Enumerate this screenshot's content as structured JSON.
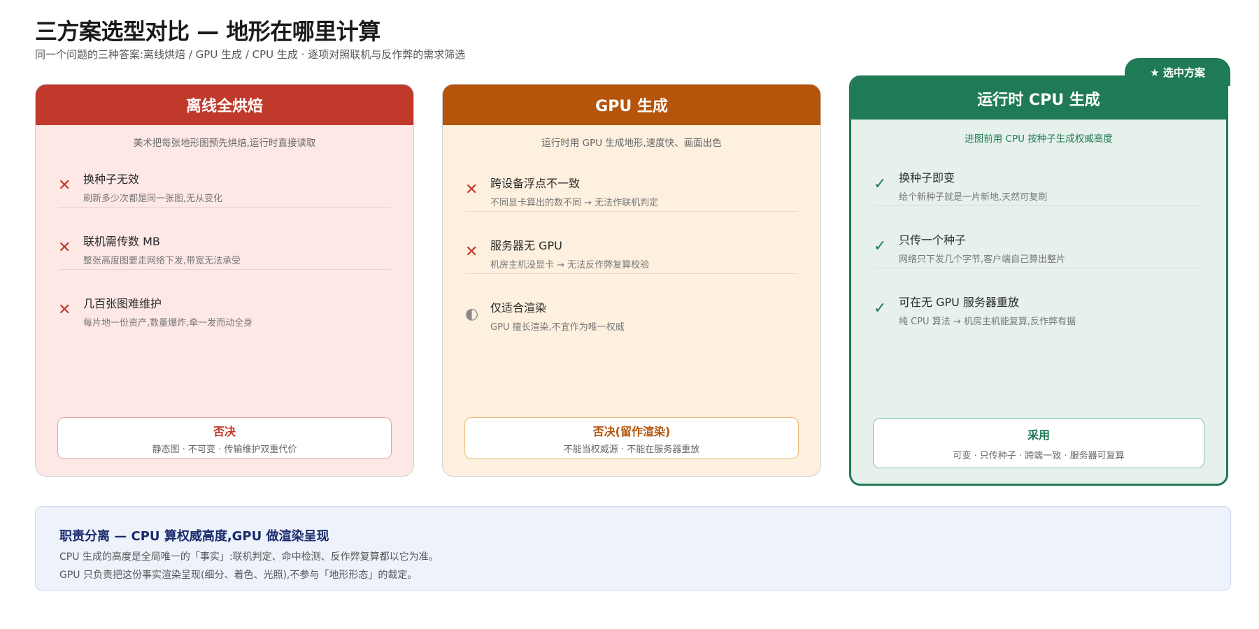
{
  "header": {
    "title": "三方案选型对比 — 地形在哪里计算",
    "subtitle": "同一个问题的三种答案:离线烘焙 / GPU 生成 / CPU 生成 · 逐项对照联机与反作弊的需求筛选"
  },
  "badge": "★ 选中方案",
  "cards": [
    {
      "title": "离线全烘焙",
      "desc": "美术把每张地形图预先烘焙,运行时直接读取",
      "items": [
        {
          "mark": "✕",
          "title": "换种子无效",
          "sub": "刷新多少次都是同一张图,无从变化"
        },
        {
          "mark": "✕",
          "title": "联机需传数 MB",
          "sub": "整张高度图要走网络下发,带宽无法承受"
        },
        {
          "mark": "✕",
          "title": "几百张图难维护",
          "sub": "每片地一份资产,数量爆炸,牵一发而动全身"
        }
      ],
      "verdict": {
        "label": "否决",
        "note": "静态图 · 不可变 · 传输维护双重代价"
      }
    },
    {
      "title": "GPU 生成",
      "desc": "运行时用 GPU 生成地形,速度快、画面出色",
      "items": [
        {
          "mark": "✕",
          "title": "跨设备浮点不一致",
          "sub": "不同显卡算出的数不同 → 无法作联机判定"
        },
        {
          "mark": "✕",
          "title": "服务器无 GPU",
          "sub": "机房主机没显卡 → 无法反作弊复算校验"
        },
        {
          "mark": "◐",
          "title": "仅适合渲染",
          "sub": "GPU 擅长渲染,不宜作为唯一权威"
        }
      ],
      "verdict": {
        "label": "否决(留作渲染)",
        "note": "不能当权威源 · 不能在服务器重放"
      }
    },
    {
      "title": "运行时 CPU 生成",
      "desc": "进图前用 CPU 按种子生成权威高度",
      "items": [
        {
          "mark": "✓",
          "title": "换种子即变",
          "sub": "给个新种子就是一片新地,天然可复刷"
        },
        {
          "mark": "✓",
          "title": "只传一个种子",
          "sub": "网络只下发几个字节,客户端自己算出整片"
        },
        {
          "mark": "✓",
          "title": "可在无 GPU 服务器重放",
          "sub": "纯 CPU 算法 → 机房主机能复算,反作弊有据"
        }
      ],
      "verdict": {
        "label": "采用",
        "note": "可变 · 只传种子 · 跨端一致 · 服务器可复算"
      }
    }
  ],
  "summary": {
    "title": "职责分离 — CPU 算权威高度,GPU 做渲染呈现",
    "line1": "CPU 生成的高度是全局唯一的「事实」:联机判定、命中检测、反作弊复算都以它为准。",
    "line2": "GPU 只负责把这份事实渲染呈现(细分、着色、光照),不参与「地形形态」的裁定。"
  },
  "colors": {
    "offline": "#c0392b",
    "gpu": "#b5540b",
    "cpu": "#1f7a56",
    "summary_title": "#1a2a6c"
  }
}
